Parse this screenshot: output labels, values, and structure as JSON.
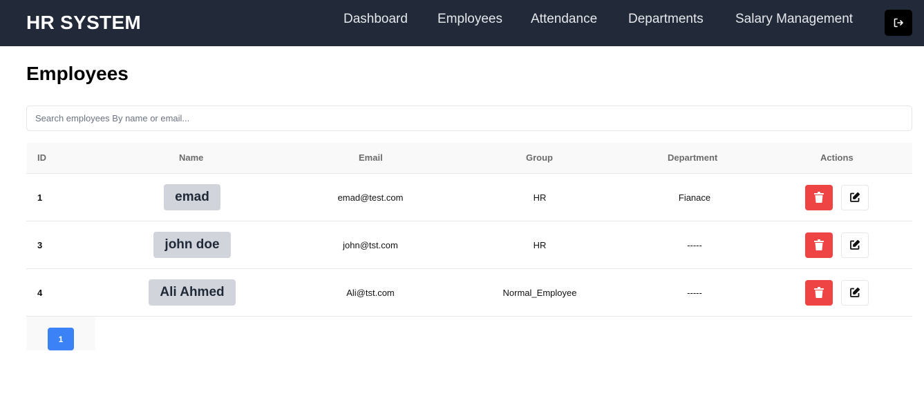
{
  "brand": "HR SYSTEM",
  "nav": [
    "Dashboard",
    "Employees",
    "Attendance",
    "Departments",
    "Salary Management"
  ],
  "logout_icon": "logout-icon",
  "page_title": "Employees",
  "search": {
    "placeholder": "Search employees By name or email..."
  },
  "table": {
    "columns": [
      "ID",
      "Name",
      "Email",
      "Group",
      "Department",
      "Actions"
    ],
    "rows": [
      {
        "id": "1",
        "name": "emad",
        "email": "emad@test.com",
        "group": "HR",
        "department": "Fianace"
      },
      {
        "id": "3",
        "name": "john doe",
        "email": "john@tst.com",
        "group": "HR",
        "department": "-----"
      },
      {
        "id": "4",
        "name": "Ali Ahmed",
        "email": "Ali@tst.com",
        "group": "Normal_Employee",
        "department": "-----"
      }
    ]
  },
  "action_icons": {
    "delete": "trash-icon",
    "edit": "edit-icon"
  },
  "colors": {
    "topbar": "#222a3a",
    "delete": "#ef4444",
    "page_active": "#3b82f6",
    "name_chip": "#d1d5db"
  },
  "pagination": {
    "current": "1"
  }
}
